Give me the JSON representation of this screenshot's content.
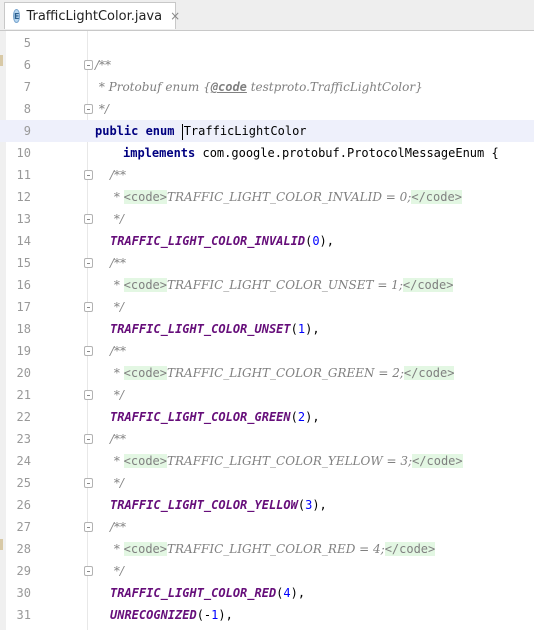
{
  "tab": {
    "icon_letter": "E",
    "title": "TrafficLightColor.java",
    "close_glyph": "×"
  },
  "lines": [
    {
      "n": "5",
      "indent": 0,
      "parts": []
    },
    {
      "n": "6",
      "indent": 0,
      "fold": true,
      "parts": [
        {
          "t": "cmt",
          "v": "/**"
        }
      ]
    },
    {
      "n": "7",
      "indent": 0,
      "parts": [
        {
          "t": "cmt",
          "v": " * Protobuf enum {"
        },
        {
          "t": "doctag",
          "v": "@code"
        },
        {
          "t": "cmt",
          "v": " testproto.TrafficLightColor}"
        }
      ]
    },
    {
      "n": "8",
      "indent": 0,
      "fold": true,
      "parts": [
        {
          "t": "cmt",
          "v": " */"
        }
      ]
    },
    {
      "n": "9",
      "indent": 0,
      "current": true,
      "parts": [
        {
          "t": "kw",
          "v": "public enum "
        },
        {
          "t": "caret",
          "v": ""
        },
        {
          "t": "plain",
          "v": "TrafficLightColor"
        }
      ]
    },
    {
      "n": "10",
      "indent": 1,
      "parts": [
        {
          "t": "kw",
          "v": "implements "
        },
        {
          "t": "plain",
          "v": "com.google.protobuf.ProtocolMessageEnum {"
        }
      ]
    },
    {
      "n": "11",
      "indent": 2,
      "fold": true,
      "parts": [
        {
          "t": "cmt",
          "v": "/**"
        }
      ]
    },
    {
      "n": "12",
      "indent": 2,
      "parts": [
        {
          "t": "cmt",
          "v": " * "
        },
        {
          "t": "tagbg",
          "v": "<code>"
        },
        {
          "t": "tagtxt",
          "v": "TRAFFIC_LIGHT_COLOR_INVALID = 0;"
        },
        {
          "t": "tagbg",
          "v": "</code>"
        }
      ]
    },
    {
      "n": "13",
      "indent": 2,
      "fold": true,
      "parts": [
        {
          "t": "cmt",
          "v": " */"
        }
      ]
    },
    {
      "n": "14",
      "indent": 2,
      "parts": [
        {
          "t": "enumc",
          "v": "TRAFFIC_LIGHT_COLOR_INVALID"
        },
        {
          "t": "plain",
          "v": "("
        },
        {
          "t": "num",
          "v": "0"
        },
        {
          "t": "plain",
          "v": "),"
        }
      ]
    },
    {
      "n": "15",
      "indent": 2,
      "fold": true,
      "parts": [
        {
          "t": "cmt",
          "v": "/**"
        }
      ]
    },
    {
      "n": "16",
      "indent": 2,
      "parts": [
        {
          "t": "cmt",
          "v": " * "
        },
        {
          "t": "tagbg",
          "v": "<code>"
        },
        {
          "t": "tagtxt",
          "v": "TRAFFIC_LIGHT_COLOR_UNSET = 1;"
        },
        {
          "t": "tagbg",
          "v": "</code>"
        }
      ]
    },
    {
      "n": "17",
      "indent": 2,
      "fold": true,
      "parts": [
        {
          "t": "cmt",
          "v": " */"
        }
      ]
    },
    {
      "n": "18",
      "indent": 2,
      "parts": [
        {
          "t": "enumc",
          "v": "TRAFFIC_LIGHT_COLOR_UNSET"
        },
        {
          "t": "plain",
          "v": "("
        },
        {
          "t": "num",
          "v": "1"
        },
        {
          "t": "plain",
          "v": "),"
        }
      ]
    },
    {
      "n": "19",
      "indent": 2,
      "fold": true,
      "parts": [
        {
          "t": "cmt",
          "v": "/**"
        }
      ]
    },
    {
      "n": "20",
      "indent": 2,
      "parts": [
        {
          "t": "cmt",
          "v": " * "
        },
        {
          "t": "tagbg",
          "v": "<code>"
        },
        {
          "t": "tagtxt",
          "v": "TRAFFIC_LIGHT_COLOR_GREEN = 2;"
        },
        {
          "t": "tagbg",
          "v": "</code>"
        }
      ]
    },
    {
      "n": "21",
      "indent": 2,
      "fold": true,
      "parts": [
        {
          "t": "cmt",
          "v": " */"
        }
      ]
    },
    {
      "n": "22",
      "indent": 2,
      "parts": [
        {
          "t": "enumc",
          "v": "TRAFFIC_LIGHT_COLOR_GREEN"
        },
        {
          "t": "plain",
          "v": "("
        },
        {
          "t": "num",
          "v": "2"
        },
        {
          "t": "plain",
          "v": "),"
        }
      ]
    },
    {
      "n": "23",
      "indent": 2,
      "fold": true,
      "parts": [
        {
          "t": "cmt",
          "v": "/**"
        }
      ]
    },
    {
      "n": "24",
      "indent": 2,
      "parts": [
        {
          "t": "cmt",
          "v": " * "
        },
        {
          "t": "tagbg",
          "v": "<code>"
        },
        {
          "t": "tagtxt",
          "v": "TRAFFIC_LIGHT_COLOR_YELLOW = 3;"
        },
        {
          "t": "tagbg",
          "v": "</code>"
        }
      ]
    },
    {
      "n": "25",
      "indent": 2,
      "fold": true,
      "parts": [
        {
          "t": "cmt",
          "v": " */"
        }
      ]
    },
    {
      "n": "26",
      "indent": 2,
      "parts": [
        {
          "t": "enumc",
          "v": "TRAFFIC_LIGHT_COLOR_YELLOW"
        },
        {
          "t": "plain",
          "v": "("
        },
        {
          "t": "num",
          "v": "3"
        },
        {
          "t": "plain",
          "v": "),"
        }
      ]
    },
    {
      "n": "27",
      "indent": 2,
      "fold": true,
      "parts": [
        {
          "t": "cmt",
          "v": "/**"
        }
      ]
    },
    {
      "n": "28",
      "indent": 2,
      "parts": [
        {
          "t": "cmt",
          "v": " * "
        },
        {
          "t": "tagbg",
          "v": "<code>"
        },
        {
          "t": "tagtxt",
          "v": "TRAFFIC_LIGHT_COLOR_RED = 4;"
        },
        {
          "t": "tagbg",
          "v": "</code>"
        }
      ]
    },
    {
      "n": "29",
      "indent": 2,
      "fold": true,
      "parts": [
        {
          "t": "cmt",
          "v": " */"
        }
      ]
    },
    {
      "n": "30",
      "indent": 2,
      "parts": [
        {
          "t": "enumc",
          "v": "TRAFFIC_LIGHT_COLOR_RED"
        },
        {
          "t": "plain",
          "v": "("
        },
        {
          "t": "num",
          "v": "4"
        },
        {
          "t": "plain",
          "v": "),"
        }
      ]
    },
    {
      "n": "31",
      "indent": 2,
      "parts": [
        {
          "t": "enumc",
          "v": "UNRECOGNIZED"
        },
        {
          "t": "plain",
          "v": "(-"
        },
        {
          "t": "num",
          "v": "1"
        },
        {
          "t": "plain",
          "v": "),"
        }
      ]
    }
  ]
}
